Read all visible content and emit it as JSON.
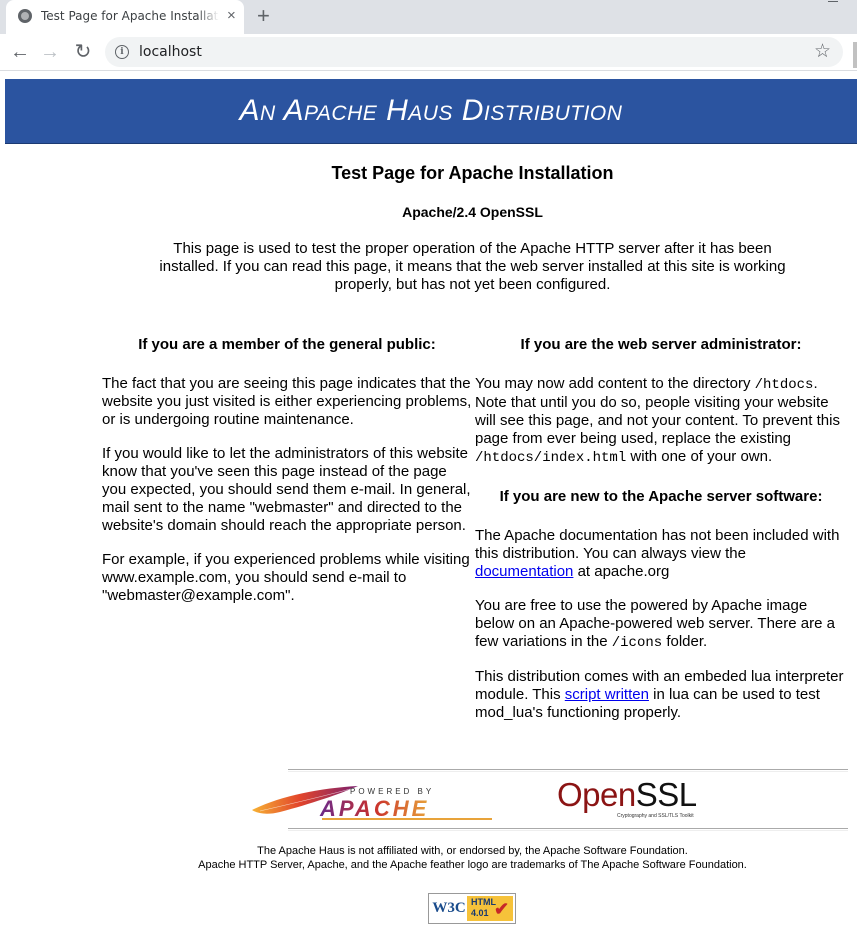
{
  "browser": {
    "tab_title": "Test Page for Apache Installati",
    "tab_close": "×",
    "new_tab": "+",
    "back": "←",
    "forward": "→",
    "reload": "↻",
    "url": "localhost",
    "star": "☆"
  },
  "banner": {
    "text": "An Apache Haus Distribution"
  },
  "heading": "Test Page for Apache Installation",
  "subheading": "Apache/2.4 OpenSSL",
  "intro": "This page is used to test the proper operation of the Apache HTTP server after it has been installed. If you can read this page, it means that the web server installed at this site is working properly, but has not yet been configured.",
  "public": {
    "title": "If you are a member of the general public:",
    "p1": "The fact that you are seeing this page indicates that the website you just visited is either experiencing problems, or is undergoing routine maintenance.",
    "p2": "If you would like to let the administrators of this website know that you've seen this page instead of the page you expected, you should send them e-mail. In general, mail sent to the name \"webmaster\" and directed to the website's domain should reach the appropriate person.",
    "p3": "For example, if you experienced problems while visiting www.example.com, you should send e-mail to \"webmaster@example.com\"."
  },
  "admin": {
    "title": "If you are the web server administrator:",
    "p1_a": "You may now add content to the directory ",
    "p1_code1": "/htdocs",
    "p1_b": ". Note that until you do so, people visiting your website will see this page, and not your content. To prevent this page from ever being used, replace the existing ",
    "p1_code2": "/htdocs/index.html",
    "p1_c": " with one of your own."
  },
  "newuser": {
    "title": "If you are new to the Apache server software:",
    "p1_a": "The Apache documentation has not been included with this distribution. You can always view the ",
    "p1_link": "documentation",
    "p1_b": " at apache.org",
    "p2_a": "You are free to use the powered by Apache image below on an Apache-powered web server. There are a few variations in the ",
    "p2_code": "/icons",
    "p2_b": " folder.",
    "p3_a": "This distribution comes with an embeded lua interpreter module. This ",
    "p3_link": "script written",
    "p3_b": " in lua can be used to test mod_lua's functioning properly."
  },
  "logos": {
    "apache_top": "POWERED BY",
    "apache_main": "APACHE",
    "openssl_open": "Open",
    "openssl_ssl": "SSL",
    "openssl_tag": "Cryptography and SSL/TLS Toolkit"
  },
  "footer": {
    "line1": "The Apache Haus is not affiliated with, or endorsed by, the Apache Software Foundation.",
    "line2": "Apache HTTP Server, Apache, and the Apache feather logo are trademarks of The Apache Software Foundation."
  },
  "w3c": {
    "left": "W3C",
    "html": "HTML",
    "version": "4.01",
    "check": "✔"
  },
  "colors": {
    "banner": "#2b54a0",
    "link": "#0000ee"
  }
}
